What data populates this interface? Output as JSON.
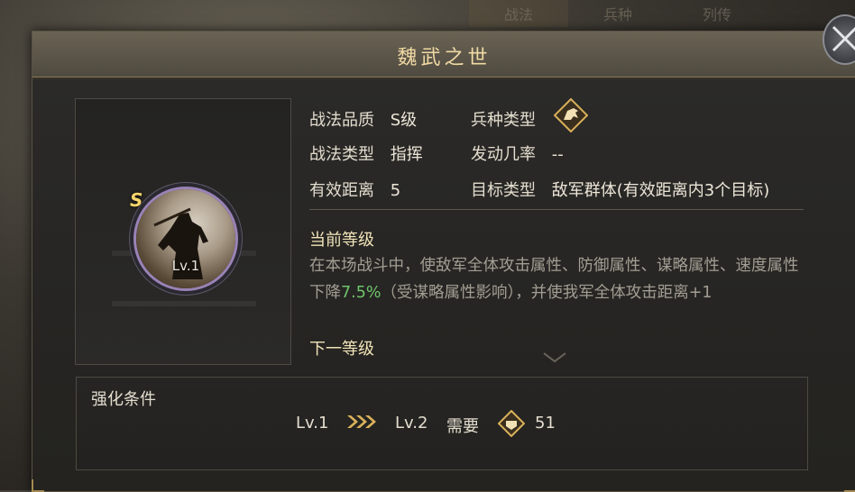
{
  "background_tabs": [
    "战法",
    "兵种",
    "列传"
  ],
  "dialog": {
    "title": "魏武之世"
  },
  "portrait": {
    "grade": "S",
    "level": "Lv.1"
  },
  "stats": {
    "quality_label": "战法品质",
    "quality_value": "S级",
    "type_label": "战法类型",
    "type_value": "指挥",
    "range_label": "有效距离",
    "range_value": "5",
    "unit_label": "兵种类型",
    "unit_icon": "cavalry-horse-icon",
    "trigger_label": "发动几率",
    "trigger_value": "--",
    "target_label": "目标类型",
    "target_value": "敌军群体(有效距离内3个目标)"
  },
  "current_level": {
    "heading": "当前等级",
    "desc_before": "在本场战斗中，使敌军全体攻击属性、防御属性、谋略属性、速度属性下降",
    "desc_highlight": "7.5%",
    "desc_after": "（受谋略属性影响），并使我军全体攻击距离+1"
  },
  "next_level": {
    "heading": "下一等级"
  },
  "upgrade": {
    "title": "强化条件",
    "from_level": "Lv.1",
    "to_level": "Lv.2",
    "need_label": "需要",
    "cost_icon": "tactic-point-icon",
    "cost_value": "51"
  },
  "colors": {
    "title": "#f0d9a4",
    "highlight": "#6ec56b",
    "gold": "#d9b15a"
  }
}
